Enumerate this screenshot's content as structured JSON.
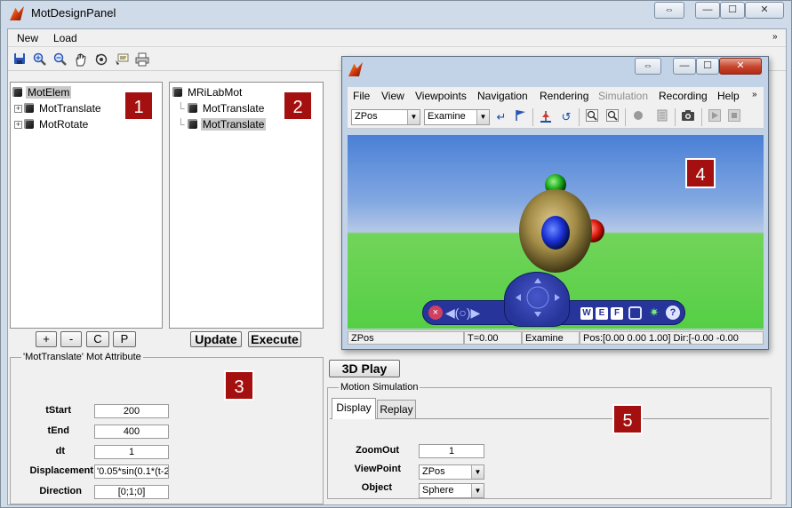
{
  "window": {
    "title": "MotDesignPanel",
    "controls": {
      "resize": "⇔",
      "minimize": "—",
      "maximize": "☐",
      "close": "✕"
    }
  },
  "menubar": {
    "items": [
      "New",
      "Load"
    ],
    "overflow": "»"
  },
  "toolbar": {
    "icons": [
      "save-icon",
      "zoom-in-icon",
      "zoom-out-icon",
      "pan-hand-icon",
      "rotate-3d-icon",
      "data-cursor-icon",
      "print-icon"
    ]
  },
  "tree1": {
    "root": "MotElem",
    "children": [
      "MotTranslate",
      "MotRotate"
    ],
    "badge": "1"
  },
  "tree2": {
    "root": "MRiLabMot",
    "children": [
      "MotTranslate",
      "MotTranslate"
    ],
    "badge": "2"
  },
  "tree_buttons": {
    "add": "+",
    "remove": "-",
    "copy": "C",
    "paste": "P"
  },
  "action_buttons": {
    "update": "Update",
    "execute": "Execute"
  },
  "attributes": {
    "title": "'MotTranslate' Mot Attribute",
    "badge": "3",
    "fields": [
      {
        "label": "tStart",
        "value": "200"
      },
      {
        "label": "tEnd",
        "value": "400"
      },
      {
        "label": "dt",
        "value": "1"
      },
      {
        "label": "Displacement",
        "value": "'0.05*sin(0.1*(t-2"
      },
      {
        "label": "Direction",
        "value": "[0;1;0]"
      }
    ]
  },
  "play_button": "3D Play",
  "motion_sim": {
    "title": "Motion Simulation",
    "tabs": [
      "Display",
      "Replay"
    ],
    "active_tab": "Display",
    "badge": "5",
    "zoomout_label": "ZoomOut",
    "zoomout_value": "1",
    "viewpoint_label": "ViewPoint",
    "viewpoint_value": "ZPos",
    "object_label": "Object",
    "object_value": "Sphere"
  },
  "viewer": {
    "controls": {
      "resize": "⇔",
      "minimize": "—",
      "maximize": "☐",
      "close": "✕"
    },
    "menu": [
      "File",
      "View",
      "Viewpoints",
      "Navigation",
      "Rendering",
      "Simulation",
      "Recording",
      "Help"
    ],
    "disabled_menu": "Simulation",
    "menu_overflow": "»",
    "viewpoint_select": "ZPos",
    "mode_select": "Examine",
    "badge": "4",
    "nav_buttons": [
      "W",
      "E",
      "F",
      "?"
    ],
    "status": {
      "viewpoint": "ZPos",
      "time": "T=0.00",
      "mode": "Examine",
      "position": "Pos:[0.00 0.00 1.00] Dir:[-0.00 -0.00"
    }
  },
  "colors": {
    "badge": "#a3100f",
    "sky_top": "#4a7fd6",
    "ground": "#55cf45",
    "nav_bar": "#27349a"
  }
}
